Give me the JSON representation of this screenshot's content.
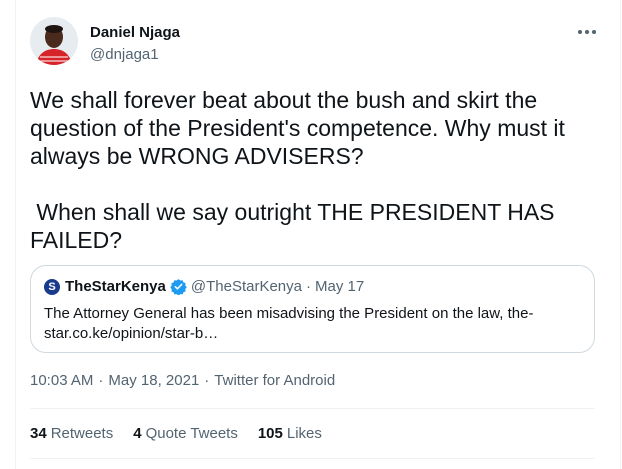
{
  "tweet": {
    "author_name": "Daniel Njaga",
    "author_handle": "@dnjaga1",
    "more_label": "···",
    "paragraphs": [
      "We shall forever beat about the bush and skirt the question of the President's competence. Why must it always be WRONG ADVISERS?",
      " When shall we say outright THE PRESIDENT HAS FAILED?"
    ],
    "quoted": {
      "logo_letter": "S",
      "name": "TheStarKenya",
      "handle": "@TheStarKenya",
      "separator": "·",
      "date": "May 17",
      "text": "The Attorney General has been misadvising the President on the law, the-star.co.ke/opinion/star-b…"
    },
    "time": "10:03 AM",
    "date": "May 18, 2021",
    "separator": "·",
    "source": "Twitter for Android",
    "stats": [
      {
        "count": "34",
        "label": "Retweets"
      },
      {
        "count": "4",
        "label": "Quote Tweets"
      },
      {
        "count": "105",
        "label": "Likes"
      }
    ]
  },
  "colors": {
    "text_primary": "#0f1419",
    "text_secondary": "#536471",
    "border": "#cfd9de",
    "verified_blue": "#1d9bf0",
    "avatar_shirt_red": "#d6232a"
  }
}
